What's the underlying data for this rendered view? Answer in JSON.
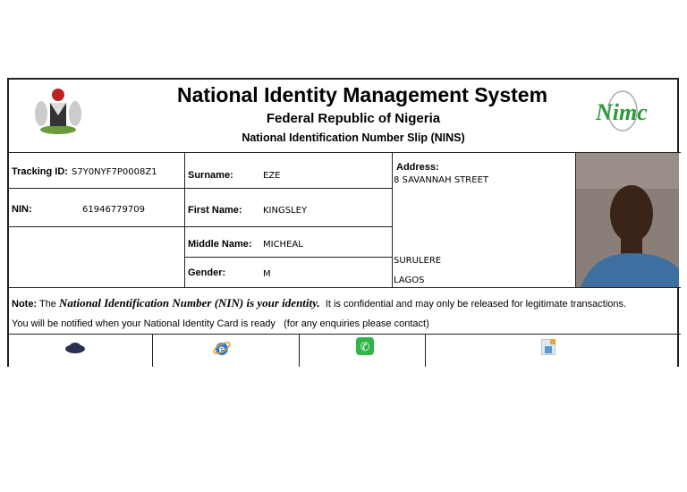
{
  "header": {
    "title": "National Identity Management System",
    "subtitle": "Federal Republic of Nigeria",
    "slip_title": "National Identification Number Slip (NINS)",
    "logo_text": "Nimc"
  },
  "fields": {
    "tracking_label": "Tracking ID:",
    "tracking_value": "S7Y0NYF7P0008Z1",
    "nin_label": "NIN:",
    "nin_value": "61946779709",
    "surname_label": "Surname:",
    "surname_value": "EZE",
    "first_label": "First Name:",
    "first_value": "KINGSLEY",
    "middle_label": "Middle Name:",
    "middle_value": "MICHEAL",
    "gender_label": "Gender:",
    "gender_value": "M",
    "address_label": "Address:",
    "address_line1": "8 SAVANNAH STREET",
    "address_line2": "SURULERE",
    "address_line3": "LAGOS"
  },
  "note": {
    "label": "Note:",
    "pre": "The",
    "emph": "National Identification Number (NIN) is your identity.",
    "post": "It is confidential and may only be released for legitimate transactions.",
    "line2": "You will be notified when your National Identity Card is ready   (for any enquiries please contact)"
  },
  "colors": {
    "nimc_green": "#2a9a3a",
    "phone_green": "#2fb54a"
  }
}
